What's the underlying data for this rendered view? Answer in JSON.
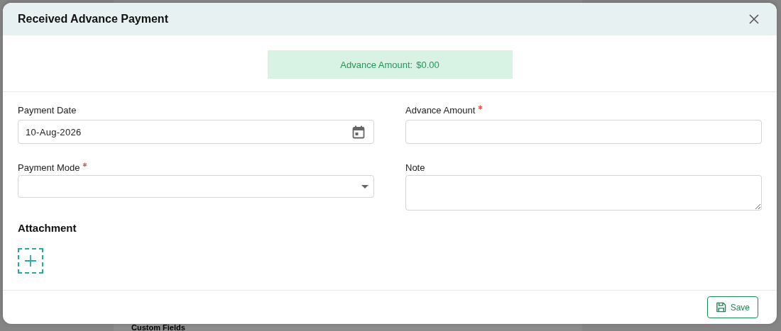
{
  "background": {
    "heading": "Custom Fields"
  },
  "dialog": {
    "title": "Received Advance Payment"
  },
  "banner": {
    "label": "Advance Amount:",
    "value": "$0.00"
  },
  "fields": [
    {
      "kind": "date",
      "label": "Payment Date",
      "required": false,
      "value": "10-Aug-2026"
    },
    {
      "kind": "text",
      "label": "Advance Amount",
      "required": true
    },
    {
      "kind": "select",
      "label": "Payment Mode",
      "required": true
    },
    {
      "kind": "textarea",
      "label": "Note",
      "required": false
    }
  ],
  "attachment": {
    "title": "Attachment"
  },
  "buttons": [
    {
      "label": "Save"
    }
  ]
}
